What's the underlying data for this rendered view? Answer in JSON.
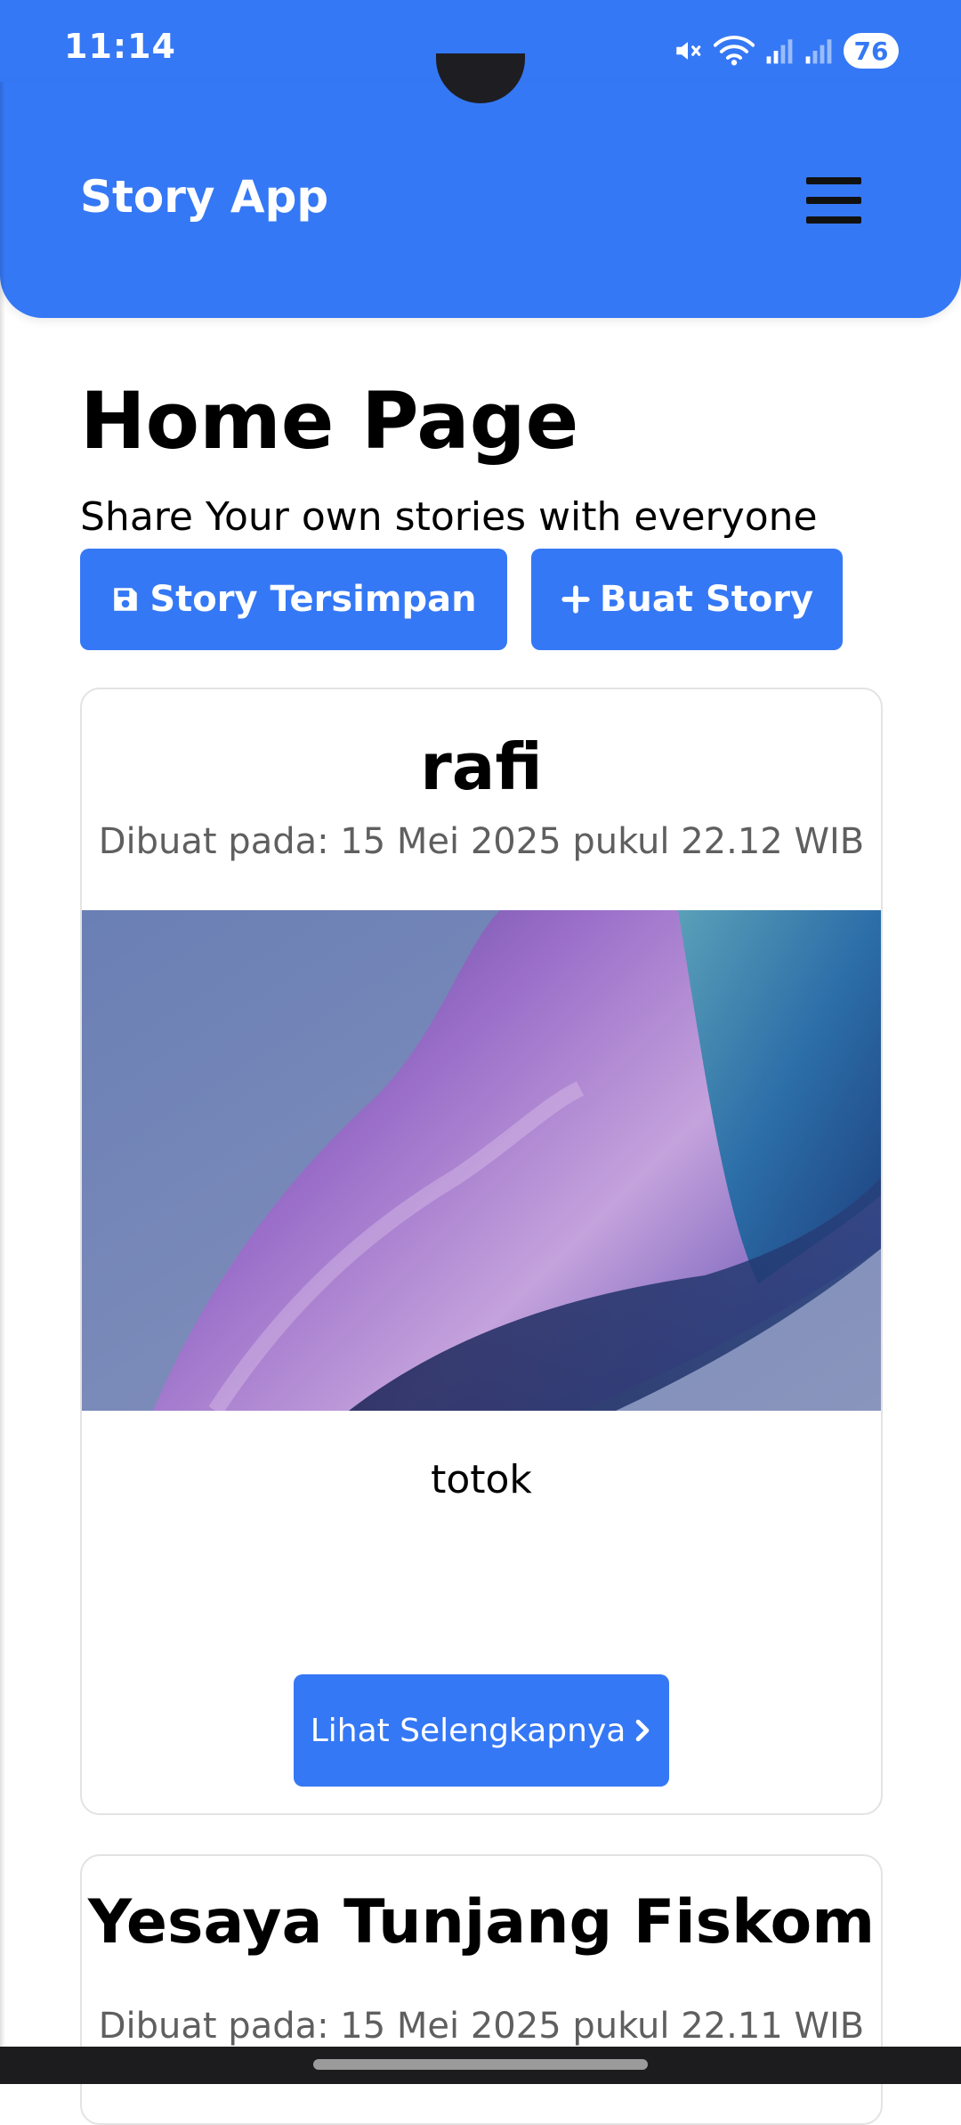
{
  "status_bar": {
    "time": "11:14",
    "battery": "76",
    "icons": [
      "mute-icon",
      "wifi-icon",
      "signal-icon",
      "signal-icon"
    ]
  },
  "app_bar": {
    "title": "Story App",
    "menu_icon": "hamburger-menu-icon"
  },
  "page": {
    "title": "Home Page",
    "subtitle": "Share Your own stories with everyone"
  },
  "actions": {
    "saved_label": "Story Tersimpan",
    "saved_icon": "save-icon",
    "create_label": "Buat Story",
    "create_icon": "plus-icon"
  },
  "stories": [
    {
      "author": "rafi",
      "date": "Dibuat pada: 15 Mei 2025 pukul 22.12 WIB",
      "description": "totok",
      "button_label": "Lihat Selengkapnya",
      "button_icon": "chevron-right-icon"
    },
    {
      "author": "Yesaya Tunjang Fiskom",
      "date": "Dibuat pada: 15 Mei 2025 pukul 22.11 WIB"
    }
  ],
  "colors": {
    "primary": "#3578f5",
    "card_border": "#e3e3e3",
    "muted_text": "#5f5f5f"
  }
}
